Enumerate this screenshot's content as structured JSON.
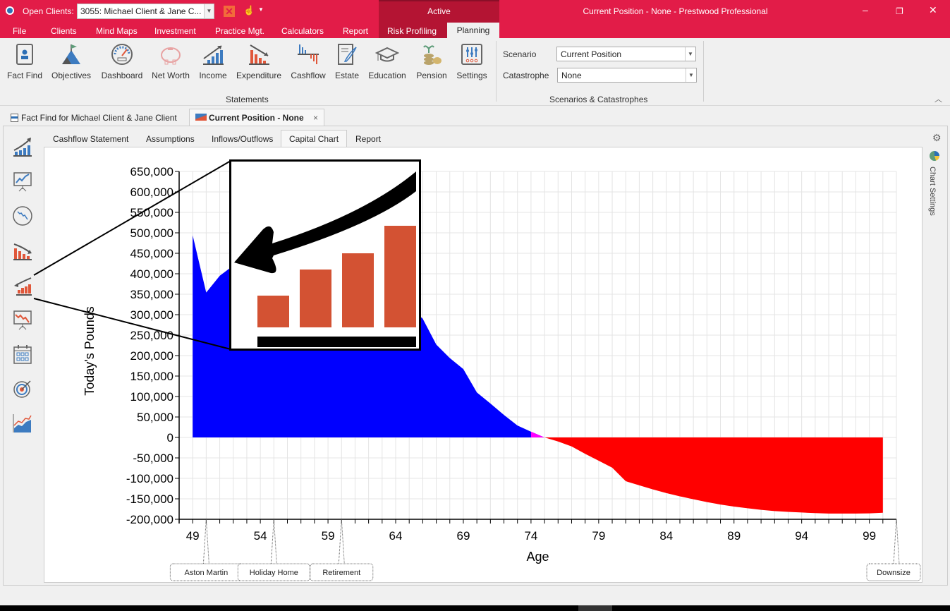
{
  "titlebar": {
    "open_clients_label": "Open Clients:",
    "client_value": "3055: Michael Client & Jane C...",
    "active_label": "Active",
    "window_title": "Current Position - None - Prestwood Professional",
    "minimize": "–",
    "restore": "❐",
    "close": "✕"
  },
  "menu": {
    "items": [
      "File",
      "Clients",
      "Mind Maps",
      "Investment",
      "Practice Mgt.",
      "Calculators",
      "Report",
      "Risk Profiling",
      "Planning"
    ]
  },
  "ribbon": {
    "buttons": [
      {
        "label": "Fact Find",
        "icon": "fact-find-icon"
      },
      {
        "label": "Objectives",
        "icon": "mountain-flag-icon"
      },
      {
        "label": "Dashboard",
        "icon": "speedometer-icon"
      },
      {
        "label": "Net Worth",
        "icon": "piggy-bank-icon"
      },
      {
        "label": "Income",
        "icon": "income-chart-icon"
      },
      {
        "label": "Expenditure",
        "icon": "expenditure-chart-icon"
      },
      {
        "label": "Cashflow",
        "icon": "cashflow-chart-icon"
      },
      {
        "label": "Estate",
        "icon": "estate-document-icon"
      },
      {
        "label": "Education",
        "icon": "graduation-cap-icon"
      },
      {
        "label": "Pension",
        "icon": "coins-plant-icon"
      },
      {
        "label": "Settings",
        "icon": "sliders-icon"
      }
    ],
    "group_statements": "Statements",
    "scenario_label": "Scenario",
    "scenario_value": "Current Position",
    "catastrophe_label": "Catastrophe",
    "catastrophe_value": "None",
    "group_scenarios": "Scenarios & Catastrophes"
  },
  "doc_tabs": [
    {
      "label": "Fact Find for Michael Client & Jane Client",
      "active": false
    },
    {
      "label": "Current Position - None",
      "active": true,
      "close": "×"
    }
  ],
  "sub_tabs": [
    "Cashflow Statement",
    "Assumptions",
    "Inflows/Outflows",
    "Capital Chart",
    "Report"
  ],
  "active_sub_tab": "Capital Chart",
  "right_panel": {
    "label": "Chart Settings"
  },
  "colors": {
    "brand": "#e21c48",
    "positive": "#0000ff",
    "transition": "#ff00ff",
    "negative": "#ff0000"
  },
  "chart_data": {
    "type": "area",
    "title": "",
    "xlabel": "Age",
    "ylabel": "Today's Pounds",
    "xlim": [
      48,
      101
    ],
    "ylim": [
      -200000,
      650000
    ],
    "yticks": [
      650000,
      600000,
      550000,
      500000,
      450000,
      400000,
      350000,
      300000,
      250000,
      200000,
      150000,
      100000,
      50000,
      0,
      -50000,
      -100000,
      -150000,
      -200000
    ],
    "ytick_labels": [
      "650,000",
      "600,000",
      "550,000",
      "500,000",
      "450,000",
      "400,000",
      "350,000",
      "300,000",
      "250,000",
      "200,000",
      "150,000",
      "100,000",
      "50,000",
      "0",
      "-50,000",
      "-100,000",
      "-150,000",
      "-200,000"
    ],
    "xticks": [
      49,
      54,
      59,
      64,
      69,
      74,
      79,
      84,
      89,
      94,
      99
    ],
    "grid": true,
    "x": [
      49,
      50,
      51,
      52,
      53,
      54,
      55,
      56,
      57,
      58,
      59,
      60,
      61,
      62,
      63,
      64,
      65,
      66,
      67,
      68,
      69,
      70,
      71,
      72,
      73,
      74,
      75,
      76,
      77,
      78,
      79,
      80,
      81,
      82,
      83,
      84,
      85,
      86,
      87,
      88,
      89,
      90,
      91,
      92,
      93,
      94,
      95,
      96,
      97,
      98,
      99,
      100
    ],
    "values": [
      494000,
      354000,
      395000,
      420000,
      430000,
      440000,
      445000,
      450000,
      448000,
      440000,
      430000,
      420000,
      400000,
      380000,
      360000,
      340000,
      320000,
      290000,
      227000,
      194000,
      167000,
      110000,
      83000,
      55000,
      29000,
      14000,
      0,
      -10000,
      -22000,
      -40000,
      -57000,
      -74000,
      -107000,
      -117000,
      -127000,
      -136000,
      -144000,
      -151000,
      -158000,
      -164000,
      -169000,
      -173000,
      -177000,
      -180000,
      -182000,
      -183500,
      -185000,
      -186000,
      -186000,
      -186000,
      -185500,
      -184000
    ],
    "annotations": [
      {
        "label": "Aston Martin",
        "age": 50
      },
      {
        "label": "Holiday Home",
        "age": 55
      },
      {
        "label": "Retirement",
        "age": 60
      },
      {
        "label": "Downsize",
        "age": 101
      }
    ]
  },
  "left_icons": [
    "growth-chart-icon",
    "presentation-growth-icon",
    "no-trend-circle-icon",
    "declining-bars-icon",
    "capital-chart-back-arrow-icon",
    "presentation-decline-icon",
    "calendar-grid-icon",
    "target-icon",
    "area-chart-icon"
  ]
}
